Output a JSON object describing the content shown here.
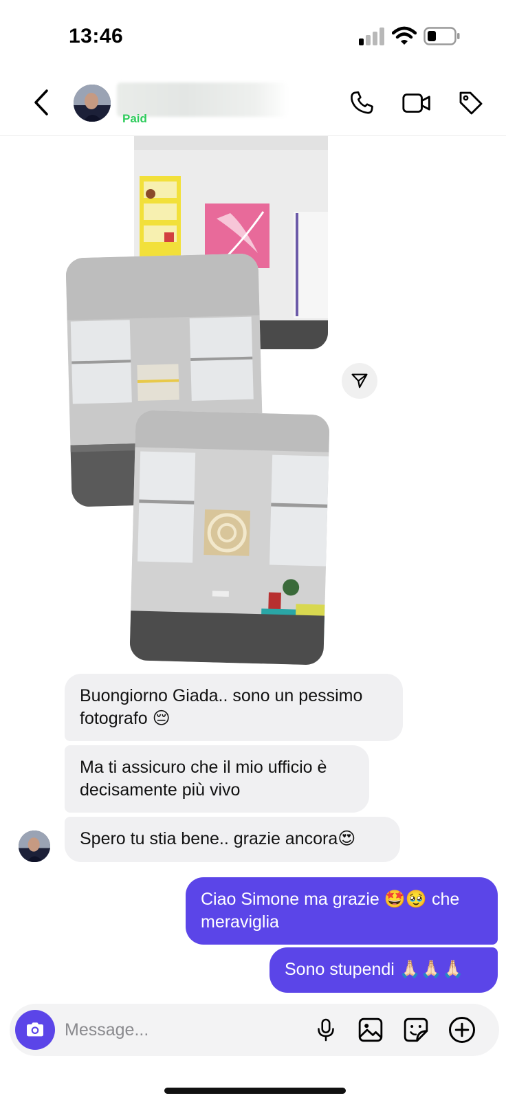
{
  "status_bar": {
    "time": "13:46"
  },
  "header": {
    "contact_status": "Paid",
    "icons": [
      "back-icon",
      "phone-icon",
      "video-camera-icon",
      "tag-icon"
    ]
  },
  "messages": [
    {
      "from": "them",
      "text": "Buongiorno Giada.. sono un pessimo fotografo 😔"
    },
    {
      "from": "them",
      "text": "Ma ti assicuro che il mio ufficio è decisamente più vivo"
    },
    {
      "from": "them",
      "text": "Spero tu stia bene.. grazie ancora😍"
    },
    {
      "from": "me",
      "text": "Ciao Simone ma grazie 🤩🥹 che meraviglia"
    },
    {
      "from": "me",
      "text": "Sono stupendi 🙏🏻🙏🏻🙏🏻"
    }
  ],
  "composer": {
    "placeholder": "Message..."
  },
  "colors": {
    "accent": "#5b45e8",
    "received_bubble": "#f0f0f2",
    "status_green": "#2ecc5c"
  }
}
